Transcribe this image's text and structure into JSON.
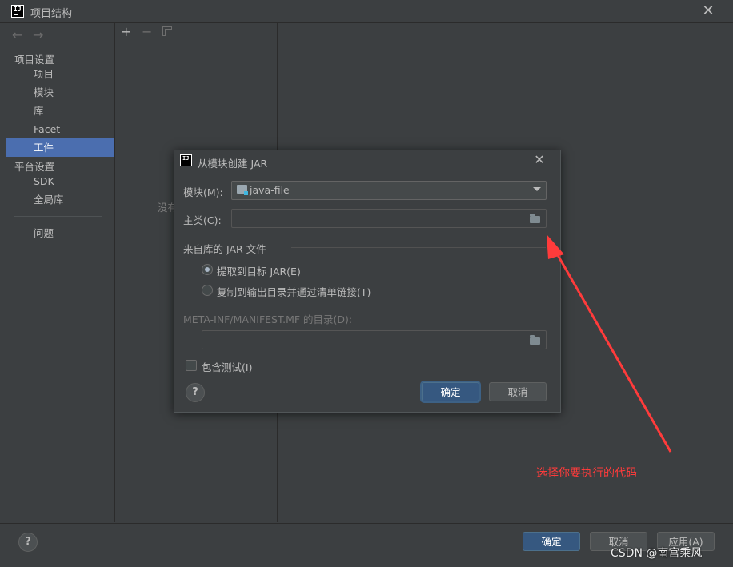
{
  "window": {
    "title": "项目结构",
    "close": "✕"
  },
  "nav": {
    "back": "←",
    "forward": "→"
  },
  "sidebar": {
    "project_settings": "项目设置",
    "project_items": [
      "项目",
      "模块",
      "库",
      "Facet",
      "工件"
    ],
    "platform_settings": "平台设置",
    "platform_items": [
      "SDK",
      "全局库"
    ],
    "problems": "问题"
  },
  "list": {
    "add": "+",
    "remove": "−",
    "empty_text": "没有"
  },
  "bottom": {
    "help": "?",
    "ok": "确定",
    "cancel": "取消",
    "apply": "应用(A)"
  },
  "dialog": {
    "title": "从模块创建 JAR",
    "close": "✕",
    "module_label": "模块(M):",
    "module_value": "java-file",
    "main_class_label": "主类(C):",
    "main_class_value": "",
    "group_label": "来自库的 JAR 文件",
    "radio_extract": "提取到目标 JAR(E)",
    "radio_copy": "复制到输出目录并通过清单链接(T)",
    "manifest_label": "META-INF/MANIFEST.MF 的目录(D):",
    "manifest_value": "",
    "include_tests": "包含测试(I)",
    "help": "?",
    "ok": "确定",
    "cancel": "取消"
  },
  "annotation": {
    "text": "选择你要执行的代码",
    "color": "#ff3b3b"
  },
  "watermark": "CSDN @南宫乘风",
  "colors": {
    "selection": "#4b6eaf",
    "primary_button": "#365880",
    "background": "#3c3f41"
  }
}
